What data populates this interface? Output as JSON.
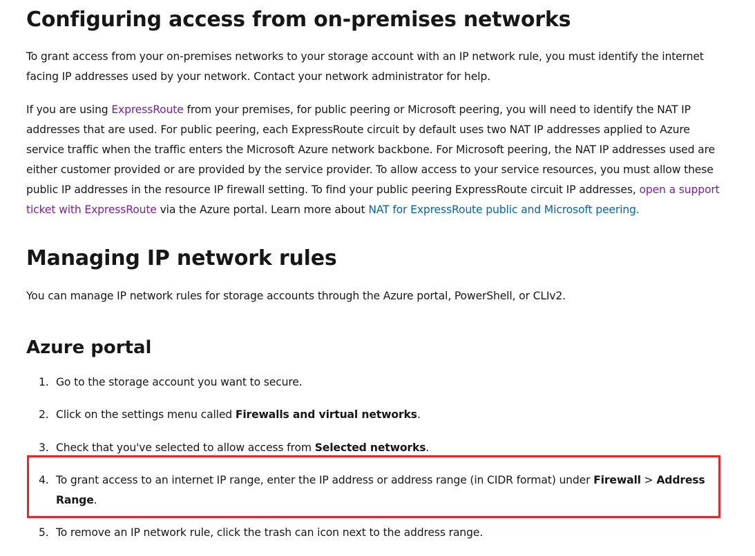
{
  "section_onprem": {
    "heading": "Configuring access from on-premises networks",
    "para1": "To grant access from your on-premises networks to your storage account with an IP network rule, you must identify the internet facing IP addresses used by your network. Contact your network administrator for help.",
    "para2_pre": "If you are using ",
    "para2_link1": "ExpressRoute",
    "para2_mid": " from your premises, for public peering or Microsoft peering, you will need to identify the NAT IP addresses that are used. For public peering, each ExpressRoute circuit by default uses two NAT IP addresses applied to Azure service traffic when the traffic enters the Microsoft Azure network backbone. For Microsoft peering, the NAT IP addresses used are either customer provided or are provided by the service provider. To allow access to your service resources, you must allow these public IP addresses in the resource IP firewall setting. To find your public peering ExpressRoute circuit IP addresses, ",
    "para2_link2": "open a support ticket with ExpressRoute",
    "para2_mid2": " via the Azure portal. Learn more about ",
    "para2_link3": "NAT for ExpressRoute public and Microsoft peering."
  },
  "section_manage": {
    "heading": "Managing IP network rules",
    "para": "You can manage IP network rules for storage accounts through the Azure portal, PowerShell, or CLIv2."
  },
  "section_portal": {
    "heading": "Azure portal",
    "steps": [
      {
        "num": "1.",
        "pre": "Go to the storage account you want to secure.",
        "bold": "",
        "post": ""
      },
      {
        "num": "2.",
        "pre": "Click on the settings menu called ",
        "bold": "Firewalls and virtual networks",
        "post": "."
      },
      {
        "num": "3.",
        "pre": "Check that you've selected to allow access from ",
        "bold": "Selected networks",
        "post": "."
      },
      {
        "num": "4.",
        "pre": "To grant access to an internet IP range, enter the IP address or address range (in CIDR format) under ",
        "bold": "Firewall",
        "mid": " > ",
        "bold2": "Address Range",
        "post": "."
      },
      {
        "num": "5.",
        "pre": "To remove an IP network rule, click the trash can icon next to the address range.",
        "bold": "",
        "post": ""
      }
    ]
  },
  "colors": {
    "visited_link": "#7a1fa2",
    "link": "#0065b3",
    "highlight_border": "#e8262a"
  }
}
